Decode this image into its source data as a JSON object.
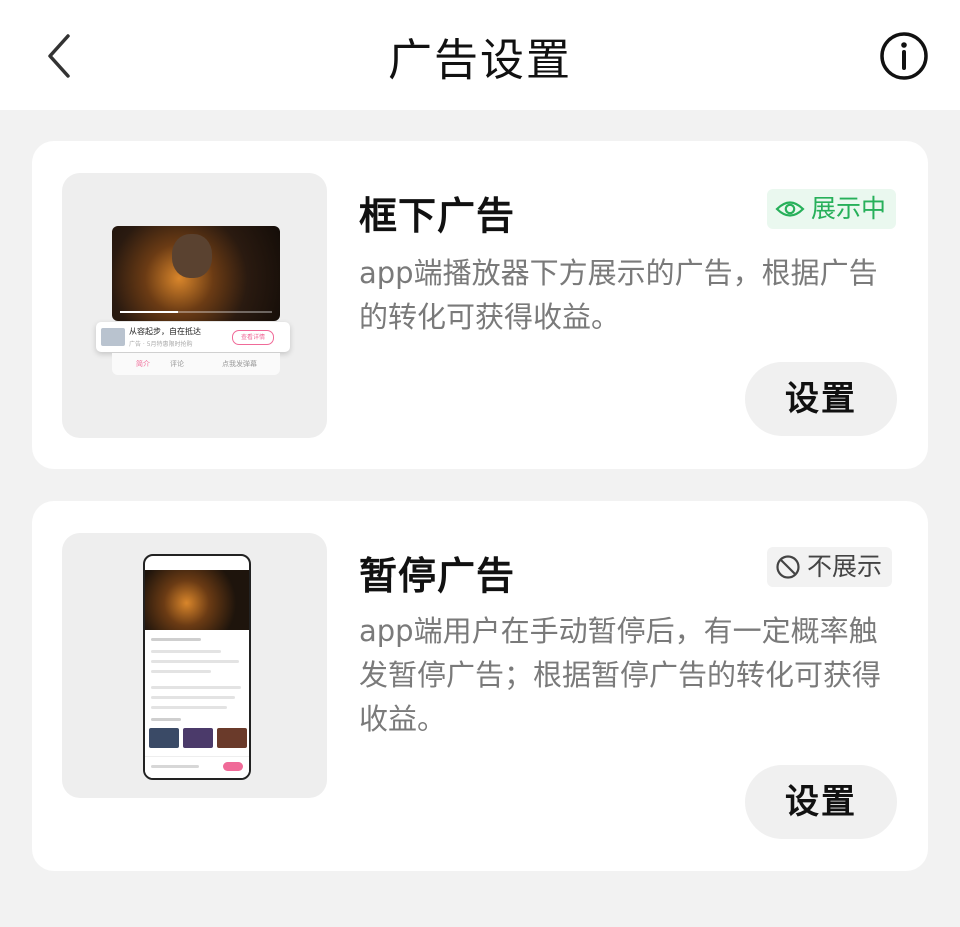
{
  "header": {
    "title": "广告设置",
    "back_icon": "chevron-left-icon",
    "info_icon": "info-icon"
  },
  "ads": [
    {
      "title": "框下广告",
      "status": "展示中",
      "status_icon": "eye-icon",
      "status_color": "#27b05a",
      "description": "app端播放器下方展示的广告，根据广告的转化可获得收益。",
      "button": "设置"
    },
    {
      "title": "暂停广告",
      "status": "不展示",
      "status_icon": "no-entry-icon",
      "status_color": "#444444",
      "description": "app端用户在手动暂停后，有一定概率触发暂停广告；根据暂停广告的转化可获得收益。",
      "button": "设置"
    }
  ],
  "preview1": {
    "ad_text": "从容起步，自在抵达",
    "ad_sub": "广告 · 5月特惠限时抢购",
    "ad_button": "查看详情",
    "tab1": "简介",
    "tab2": "评论",
    "tab3": "点我发弹幕"
  }
}
